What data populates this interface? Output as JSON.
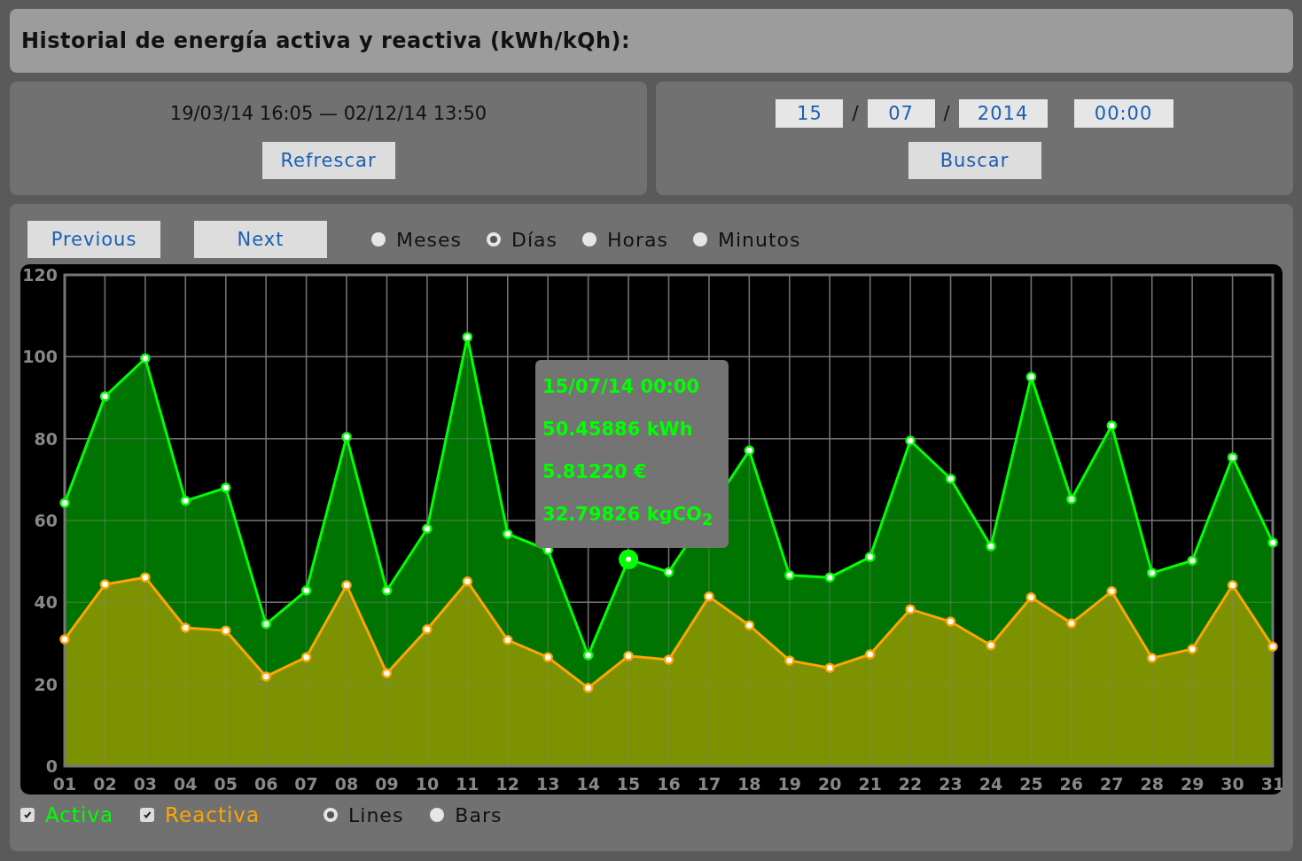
{
  "header": {
    "title": "Historial de energía activa y reactiva (kWh/kQh):"
  },
  "range_panel": {
    "range": "19/03/14 16:05 — 02/12/14 13:50",
    "button": "Refrescar"
  },
  "search_panel": {
    "day": "15",
    "sep1": "/",
    "month": "07",
    "sep2": "/",
    "year": "2014",
    "time": "00:00",
    "button": "Buscar"
  },
  "nav": {
    "previous": "Previous",
    "next": "Next"
  },
  "periods": [
    {
      "label": "Meses",
      "selected": false
    },
    {
      "label": "Días",
      "selected": true
    },
    {
      "label": "Horas",
      "selected": false
    },
    {
      "label": "Minutos",
      "selected": false
    }
  ],
  "chart_data": {
    "type": "area",
    "categories": [
      "01",
      "02",
      "03",
      "04",
      "05",
      "06",
      "07",
      "08",
      "09",
      "10",
      "11",
      "12",
      "13",
      "14",
      "15",
      "16",
      "17",
      "18",
      "19",
      "20",
      "21",
      "22",
      "23",
      "24",
      "25",
      "26",
      "27",
      "28",
      "29",
      "30",
      "31"
    ],
    "ylim": [
      0,
      120
    ],
    "yticks": [
      0,
      20,
      40,
      60,
      80,
      100,
      120
    ],
    "grid": true,
    "series": [
      {
        "name": "Activa",
        "color": "#00ff00",
        "values": [
          64.3,
          90.3,
          99.6,
          64.8,
          68,
          34.7,
          42.9,
          80.4,
          42.9,
          58,
          104.8,
          56.7,
          52.8,
          27.1,
          50.5,
          47.4,
          null,
          77.1,
          46.6,
          46.1,
          51.1,
          79.5,
          70.2,
          53.7,
          95.1,
          65.2,
          83.2,
          47.2,
          50.2,
          75.4,
          54.6
        ]
      },
      {
        "name": "Reactiva",
        "color": "#ffa500",
        "values": [
          31,
          44.4,
          46.1,
          33.8,
          33.1,
          21.9,
          26.6,
          44.2,
          22.7,
          33.4,
          45.1,
          30.8,
          26.6,
          19.1,
          26.9,
          26,
          41.4,
          34.4,
          25.8,
          24,
          27.3,
          38.3,
          35.3,
          29.5,
          41.2,
          34.9,
          42.7,
          26.4,
          28.6,
          44.2,
          29.2
        ]
      }
    ],
    "annotations": [
      {
        "x": "15"
      }
    ]
  },
  "tooltip": {
    "lines": [
      "15/07/14 00:00",
      "50.45886 kWh",
      "5.81220 €",
      "32.79826 kgCO$_{2}$"
    ]
  },
  "series_toggles": [
    {
      "checked": true
    },
    {
      "checked": true
    }
  ],
  "chart_types": [
    {
      "label": "Lines",
      "selected": true
    },
    {
      "label": "Bars",
      "selected": false
    }
  ]
}
